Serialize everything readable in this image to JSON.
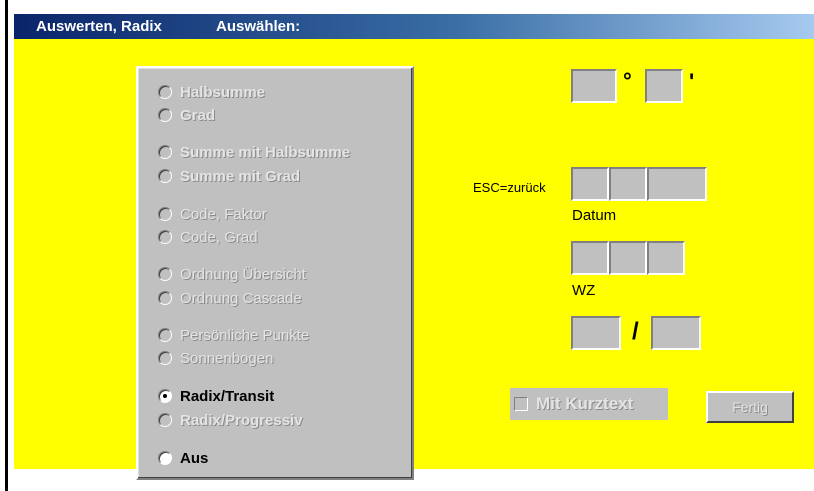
{
  "titlebar": {
    "title": "Auswerten, Radix",
    "subtitle": "Auswählen:"
  },
  "options": [
    {
      "label": "Halbsumme"
    },
    {
      "label": "Grad"
    },
    {
      "label": "Summe mit Halbsumme"
    },
    {
      "label": "Summe mit Grad"
    },
    {
      "label": "Code, Faktor"
    },
    {
      "label": "Code, Grad"
    },
    {
      "label": "Ordnung Übersicht"
    },
    {
      "label": "Ordnung Cascade"
    },
    {
      "label": "Persönliche Punkte"
    },
    {
      "label": "Sonnenbogen"
    },
    {
      "label": "Radix/Transit",
      "selected": true
    },
    {
      "label": "Radix/Progressiv"
    },
    {
      "label": "Aus"
    }
  ],
  "angle": {
    "degree_symbol": "°",
    "minute_symbol": "'"
  },
  "date": {
    "esc_hint": "ESC=zurück",
    "label": "Datum"
  },
  "time": {
    "label": "WZ"
  },
  "ratio": {
    "separator": "/"
  },
  "checkbox": {
    "label": "Mit Kurztext",
    "checked": false
  },
  "button": {
    "label": "Fertig"
  }
}
